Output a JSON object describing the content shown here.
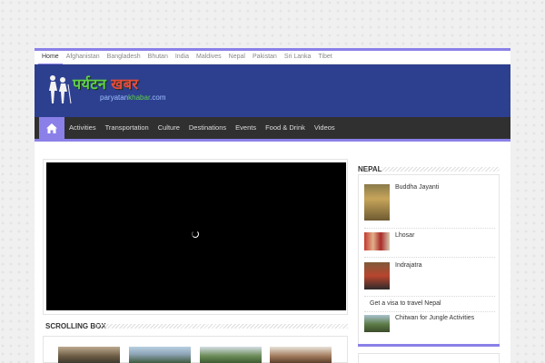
{
  "topnav": {
    "items": [
      {
        "label": "Home",
        "active": true
      },
      {
        "label": "Afghanistan"
      },
      {
        "label": "Bangladesh"
      },
      {
        "label": "Bhutan"
      },
      {
        "label": "India"
      },
      {
        "label": "Maldives"
      },
      {
        "label": "Nepal"
      },
      {
        "label": "Pakistan"
      },
      {
        "label": "Sri Lanka"
      },
      {
        "label": "Tibet"
      }
    ]
  },
  "logo": {
    "title_part1": "पर्यटन",
    "title_part2": "खबर",
    "sub_part1": "paryatan",
    "sub_part2": "khabar",
    "sub_part3": ".com"
  },
  "mainnav": {
    "home_icon": "home-icon",
    "items": [
      "Activities",
      "Transportation",
      "Culture",
      "Destinations",
      "Events",
      "Food & Drink",
      "Videos"
    ]
  },
  "video": {
    "state": "loading"
  },
  "scrolling_box": {
    "title": "SCROLLING BOX"
  },
  "sidebar": {
    "title": "NEPAL",
    "items": [
      {
        "label": "Buddha Jayanti",
        "thumb": "buddha-statue"
      },
      {
        "label": "Lhosar",
        "thumb": "festival-dancers"
      },
      {
        "label": "Indrajatra",
        "thumb": "festival-crowd"
      },
      {
        "label": "Get a visa to travel Nepal",
        "thumb": ""
      },
      {
        "label": "Chitwan for Jungle Activities",
        "thumb": "jungle-landscape"
      }
    ]
  },
  "colors": {
    "accent": "#8a80e8",
    "header_bg": "#2d3f8f",
    "nav_bg": "#303030",
    "logo_green": "#5fd04a",
    "logo_red": "#e84a3c"
  }
}
